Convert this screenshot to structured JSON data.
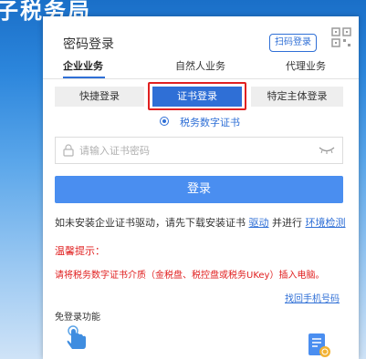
{
  "background": {
    "title": "子税务局"
  },
  "panel": {
    "title": "密码登录",
    "qr_button": "扫码登录",
    "tabs": [
      {
        "label": "企业业务",
        "active": true
      },
      {
        "label": "自然人业务",
        "active": false
      },
      {
        "label": "代理业务",
        "active": false
      }
    ],
    "subtabs": [
      {
        "label": "快捷登录",
        "active": false
      },
      {
        "label": "证书登录",
        "active": true
      },
      {
        "label": "特定主体登录",
        "active": false
      }
    ],
    "radio_option": "税务数字证书",
    "password_placeholder": "请输入证书密码",
    "login_button": "登录",
    "notice": {
      "prefix": "如未安装企业证书驱动，请先下载安装证书",
      "driver_link": "驱动",
      "middle": "并进行",
      "env_link": "环境检测"
    },
    "tip_title": "温馨提示：",
    "tip_text": "请将税务数字证书介质（金税盘、税控盘或税务UKey）插入电脑。",
    "find_phone_link": "找回手机号码",
    "free_login_label": "免登录功能"
  },
  "colors": {
    "accent": "#2f6fd6",
    "login_button": "#4a8ef0",
    "warning": "#e02020",
    "highlight_border": "#e02020"
  }
}
